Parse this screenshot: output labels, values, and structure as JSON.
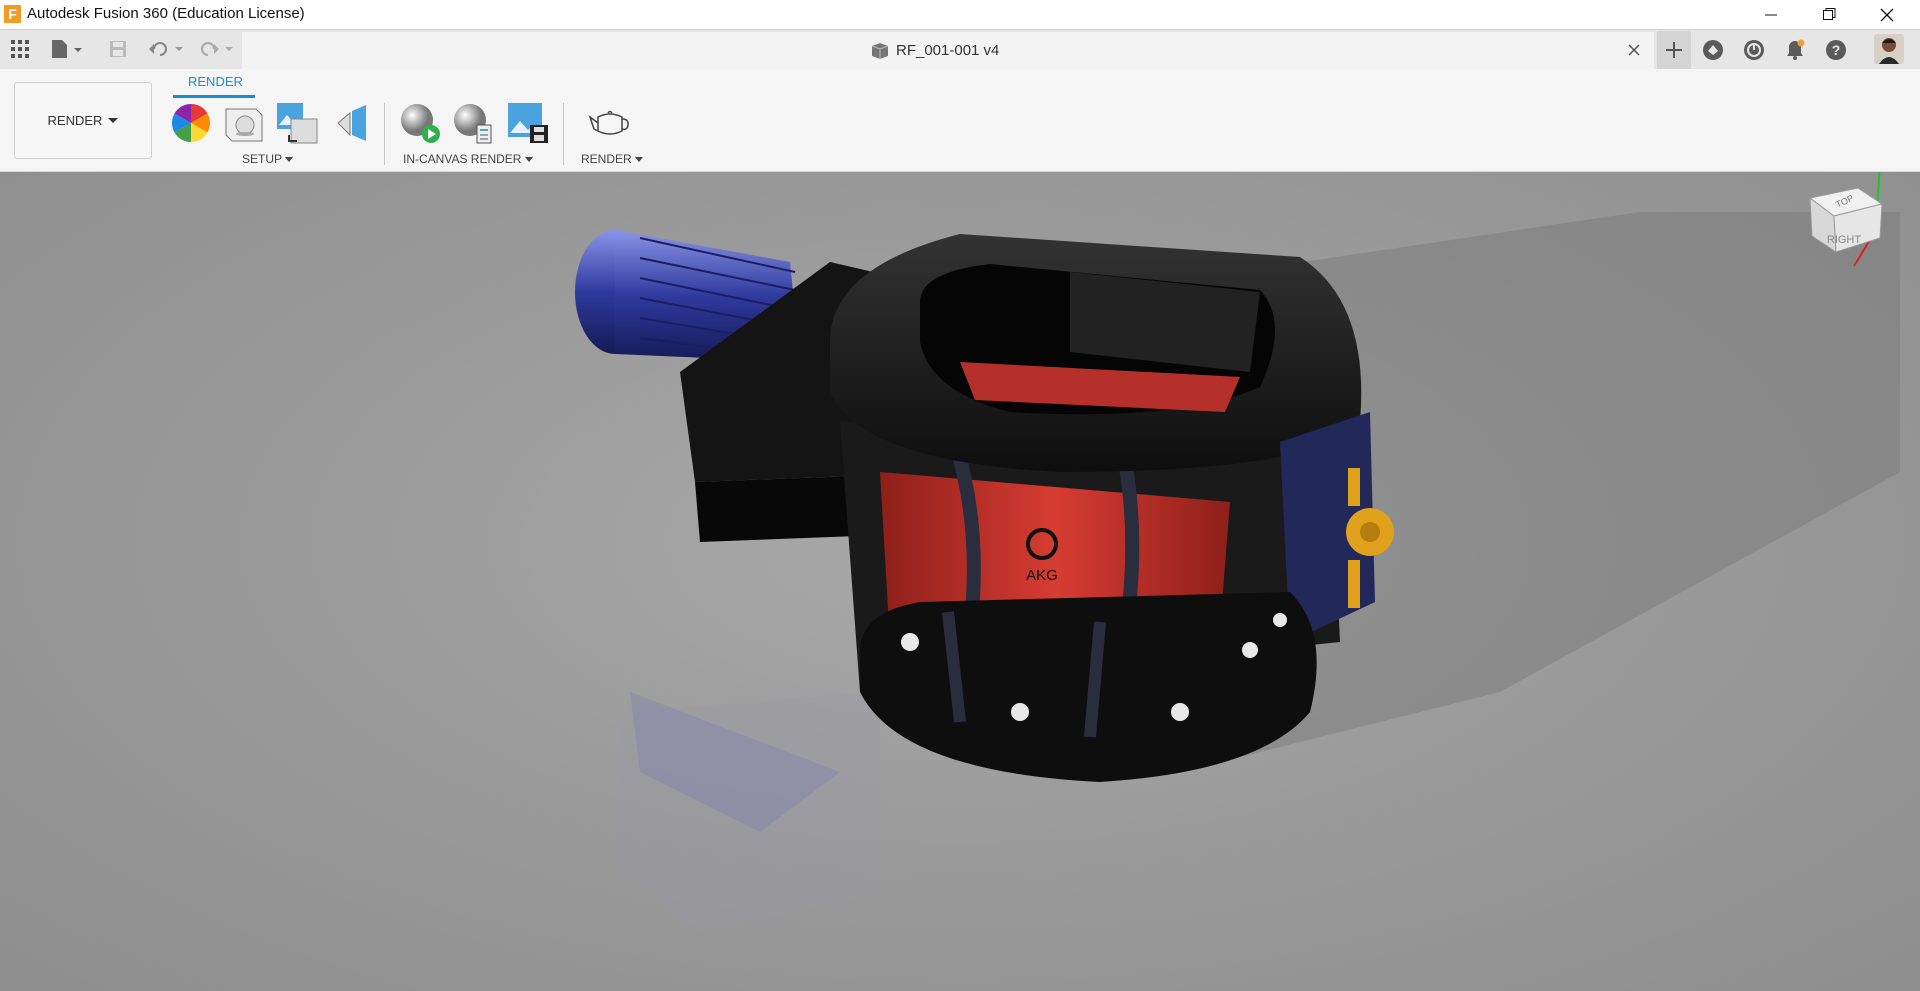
{
  "window": {
    "app_title": "Autodesk Fusion 360 (Education License)",
    "logo_letter": "F",
    "minimize_icon": "minimize-icon",
    "restore_icon": "restore-icon",
    "close_icon": "close-icon"
  },
  "appbar": {
    "grid_icon": "app-grid-icon",
    "file_icon": "file-menu-icon",
    "save_icon": "save-icon",
    "undo_icon": "undo-icon",
    "redo_icon": "redo-icon",
    "document_title": "RF_001-001 v4",
    "close_tab_icon": "close-tab-icon",
    "right_icons": [
      "new-tab-icon",
      "extensions-icon",
      "job-status-icon",
      "notifications-icon",
      "help-icon",
      "user-avatar"
    ]
  },
  "ribbon": {
    "workspace_label": "RENDER",
    "active_tab": "RENDER",
    "groups": [
      {
        "label": "SETUP",
        "tools": [
          "appearance-icon",
          "scene-settings-icon",
          "texture-map-icon",
          "decal-icon"
        ]
      },
      {
        "label": "IN-CANVAS RENDER",
        "tools": [
          "in-canvas-render-icon",
          "in-canvas-render-settings-icon",
          "capture-image-icon"
        ]
      },
      {
        "label": "RENDER",
        "tools": [
          "render-teapot-icon"
        ]
      }
    ]
  },
  "viewcube": {
    "face_front": "RIGHT",
    "face_top": "TOP"
  },
  "model": {
    "badge_text": "AKG"
  },
  "colors": {
    "accent": "#1a8fd8",
    "logo": "#f59a23",
    "rotor_red": "#c8322a",
    "motor_blue": "#2f3a9e",
    "brass": "#e0a21c"
  }
}
